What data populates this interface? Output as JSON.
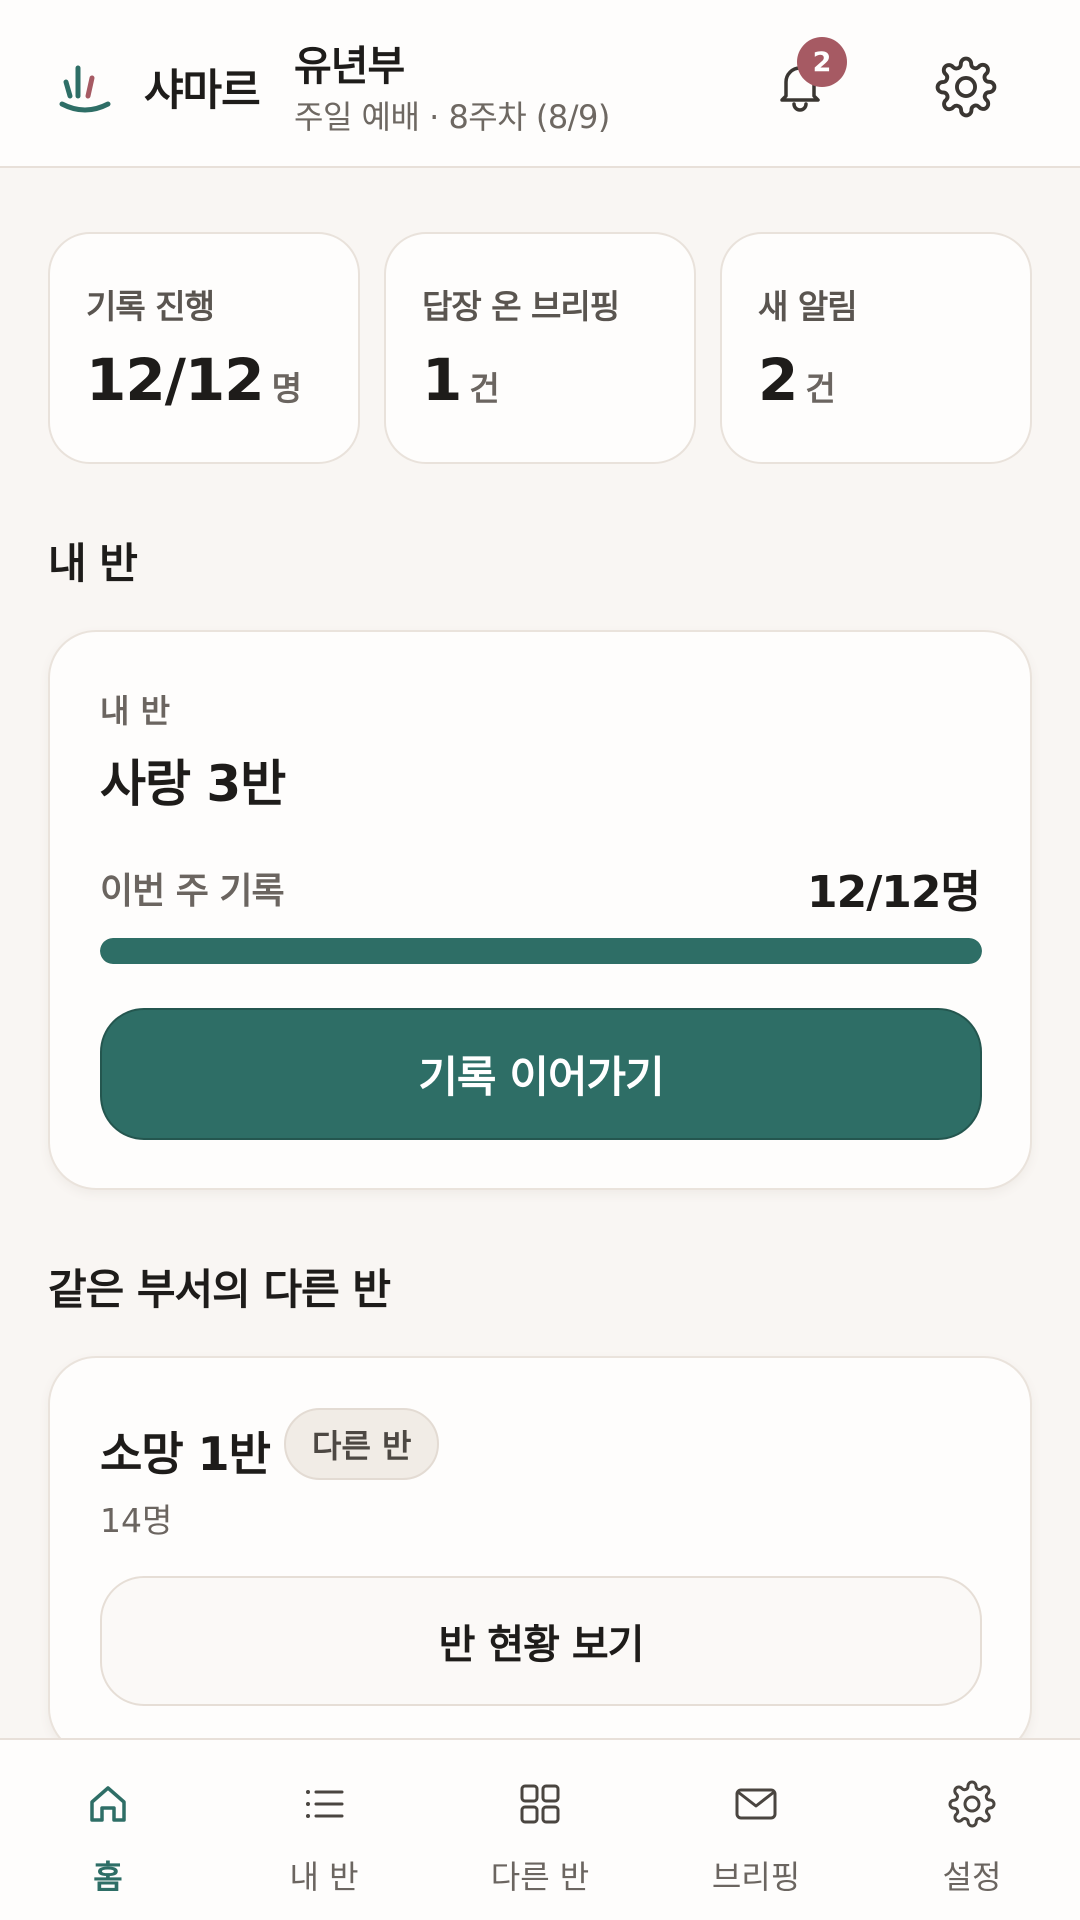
{
  "header": {
    "brand": "샤마르",
    "department": "유년부",
    "subtitle": "주일 예배 · 8주차 (8/9)",
    "notification_count": "2"
  },
  "stats": [
    {
      "label": "기록 진행",
      "value": "12/12",
      "unit": "명"
    },
    {
      "label": "답장 온 브리핑",
      "value": "1",
      "unit": "건"
    },
    {
      "label": "새 알림",
      "value": "2",
      "unit": "건"
    }
  ],
  "my_class_section": {
    "title": "내 반",
    "card": {
      "eyebrow": "내 반",
      "class_name": "사랑 3반",
      "progress_label": "이번 주 기록",
      "progress_value": "12/12명",
      "progress_fraction": 1.0,
      "cta_label": "기록 이어가기"
    }
  },
  "other_classes_section": {
    "title": "같은 부서의 다른 반",
    "items": [
      {
        "name": "소망 1반",
        "tag": "다른 반",
        "count": "14명",
        "button_label": "반 현황 보기"
      }
    ]
  },
  "bottom_nav": {
    "items": [
      {
        "label": "홈",
        "icon": "home-icon",
        "active": true
      },
      {
        "label": "내 반",
        "icon": "list-icon",
        "active": false
      },
      {
        "label": "다른 반",
        "icon": "grid-icon",
        "active": false
      },
      {
        "label": "브리핑",
        "icon": "mail-icon",
        "active": false
      },
      {
        "label": "설정",
        "icon": "gear-icon",
        "active": false
      }
    ]
  },
  "colors": {
    "accent": "#2e6e66",
    "badge": "#a65a63",
    "background": "#f9f6f3",
    "card": "#fefdfc"
  }
}
